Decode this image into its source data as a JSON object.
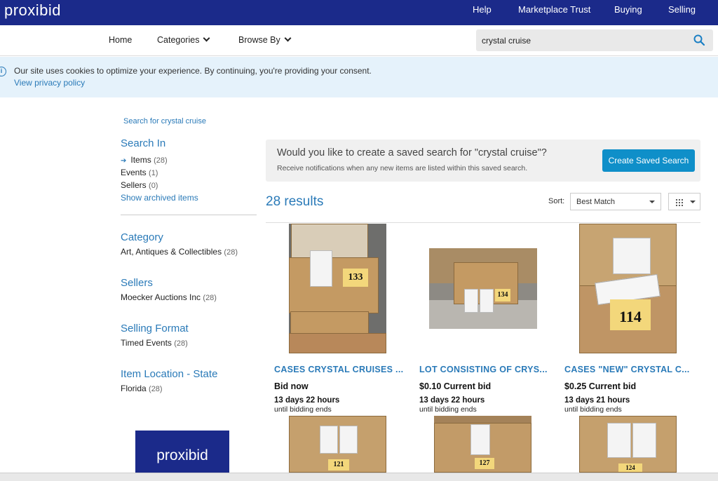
{
  "brand": {
    "logo_text": "proxibid",
    "accent": "#1b2a8a",
    "link_color": "#2a7ab8",
    "button_color": "#0f8fc9"
  },
  "topnav": {
    "help": "Help",
    "marketplace_trust": "Marketplace Trust",
    "buying": "Buying",
    "selling": "Selling"
  },
  "nav": {
    "home": "Home",
    "categories": "Categories",
    "browse_by": "Browse By"
  },
  "search": {
    "value": "crystal cruise",
    "icon": "search-icon"
  },
  "cookie": {
    "message": "Our site uses cookies to optimize your experience. By continuing, you're providing your consent.",
    "link": "View privacy policy"
  },
  "sidebar": {
    "breadcrumb": "Search for crystal cruise",
    "search_in": {
      "heading": "Search In",
      "items": [
        {
          "label": "Items",
          "count": "(28)"
        },
        {
          "label": "Events",
          "count": "(1)"
        },
        {
          "label": "Sellers",
          "count": "(0)"
        }
      ],
      "archived_link": "Show archived items"
    },
    "category": {
      "heading": "Category",
      "label": "Art, Antiques & Collectibles",
      "count": "(28)"
    },
    "sellers": {
      "heading": "Sellers",
      "label": "Moecker Auctions Inc",
      "count": "(28)"
    },
    "selling_format": {
      "heading": "Selling Format",
      "label": "Timed Events",
      "count": "(28)"
    },
    "item_location": {
      "heading": "Item Location - State",
      "label": "Florida",
      "count": "(28)"
    },
    "logo_text": "proxibid"
  },
  "saved_search": {
    "question": "Would you like to create a saved search for \"crystal cruise\"?",
    "subtext": "Receive notifications when any new items are listed within this saved search.",
    "button": "Create Saved Search"
  },
  "results": {
    "count_text": "28 results",
    "sort_label": "Sort:",
    "sort_value": "Best Match"
  },
  "items": [
    {
      "title": "CASES CRYSTAL CRUISES ...",
      "bid": "Bid now",
      "time": "13 days 22 hours",
      "ends": "until bidding ends",
      "lot": "133"
    },
    {
      "title": "LOT CONSISTING OF CRYS...",
      "bid": "$0.10 Current bid",
      "time": "13 days 22 hours",
      "ends": "until bidding ends",
      "lot": "134"
    },
    {
      "title": "CASES \"NEW\" CRYSTAL C...",
      "bid": "$0.25 Current bid",
      "time": "13 days 21 hours",
      "ends": "until bidding ends",
      "lot": "114"
    }
  ],
  "row2_lots": [
    "121",
    "127",
    "124"
  ]
}
